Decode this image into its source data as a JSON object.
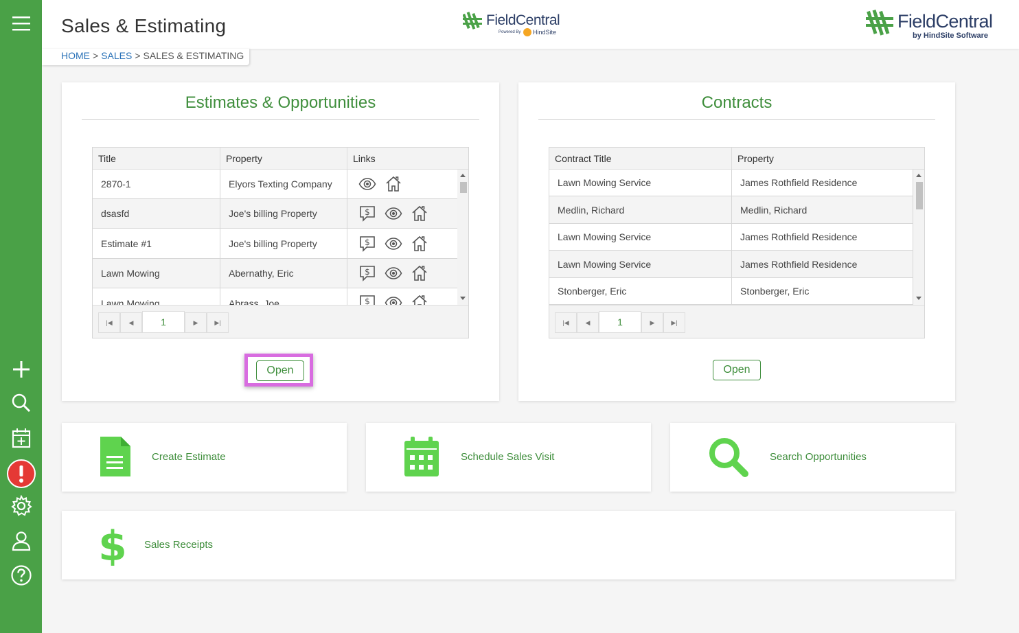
{
  "header": {
    "page_title": "Sales & Estimating",
    "breadcrumb": {
      "home": "HOME",
      "sales": "SALES",
      "current": "SALES & ESTIMATING",
      "separator": ">"
    },
    "logo_center": {
      "name": "FieldCentral",
      "powered_by": "Powered By",
      "brand": "HindSite"
    },
    "logo_right": {
      "name": "FieldCentral",
      "tagline": "by HindSite Software"
    }
  },
  "sidebar": {
    "icons": [
      "menu-icon",
      "plus-icon",
      "search-icon",
      "calendar-add-icon",
      "alert-icon",
      "gear-icon",
      "user-icon",
      "help-icon"
    ]
  },
  "estimates": {
    "title": "Estimates & Opportunities",
    "columns": [
      "Title",
      "Property",
      "Links"
    ],
    "rows": [
      {
        "title": "2870-1",
        "property": "Elyors Texting Company",
        "links": [
          "view",
          "home"
        ]
      },
      {
        "title": "dsasfd",
        "property": "Joe's billing Property",
        "links": [
          "quote",
          "view",
          "home"
        ]
      },
      {
        "title": "Estimate #1",
        "property": "Joe's billing Property",
        "links": [
          "quote",
          "view",
          "home"
        ]
      },
      {
        "title": "Lawn Mowing",
        "property": "Abernathy, Eric",
        "links": [
          "quote",
          "view",
          "home"
        ]
      },
      {
        "title": "Lawn Mowing",
        "property": "Abrass, Joe",
        "links": [
          "quote",
          "view",
          "home"
        ]
      }
    ],
    "page": "1",
    "open_label": "Open"
  },
  "contracts": {
    "title": "Contracts",
    "columns": [
      "Contract Title",
      "Property"
    ],
    "rows": [
      {
        "title": "Lawn Mowing Service",
        "property": "James Rothfield Residence"
      },
      {
        "title": "Medlin, Richard",
        "property": "Medlin, Richard"
      },
      {
        "title": "Lawn Mowing Service",
        "property": "James Rothfield Residence"
      },
      {
        "title": "Lawn Mowing Service",
        "property": "James Rothfield Residence"
      },
      {
        "title": "Stonberger, Eric",
        "property": "Stonberger, Eric"
      }
    ],
    "page": "1",
    "open_label": "Open"
  },
  "actions": {
    "create_estimate": "Create Estimate",
    "schedule_sales_visit": "Schedule Sales Visit",
    "search_opportunities": "Search Opportunities",
    "sales_receipts": "Sales Receipts"
  },
  "colors": {
    "sidebar": "#4aa147",
    "accent": "#3f8e3c",
    "icon_green": "#5fd34e",
    "link_blue": "#2a72b8",
    "highlight": "#d86ce0",
    "alert_red": "#e53935"
  }
}
